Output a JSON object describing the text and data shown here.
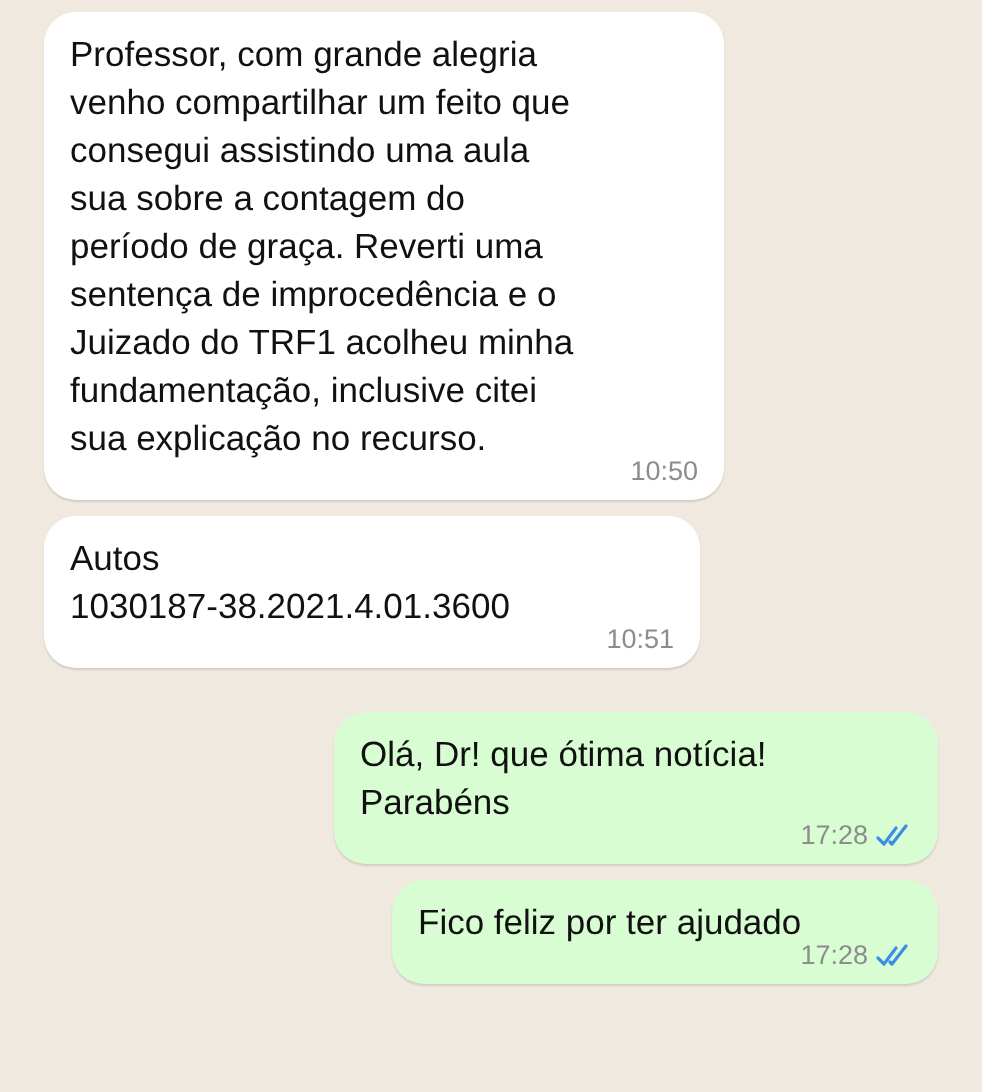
{
  "messages": [
    {
      "kind": "incoming",
      "text": "Professor, com grande alegria\nvenho compartilhar um feito que\nconsegui assistindo uma aula\nsua sobre a contagem do\nperíodo de graça. Reverti uma\nsentença de improcedência e o\nJuizado do TRF1 acolheu minha\nfundamentação, inclusive citei\nsua explicação no recurso.",
      "time": "10:50"
    },
    {
      "kind": "incoming",
      "text": "Autos\n1030187-38.2021.4.01.3600",
      "time": "10:51"
    },
    {
      "kind": "outgoing",
      "text": "Olá, Dr! que ótima notícia!\nParabéns",
      "time": "17:28",
      "read": true
    },
    {
      "kind": "outgoing",
      "text": "Fico feliz por ter ajudado",
      "time": "17:28",
      "read": true
    }
  ]
}
